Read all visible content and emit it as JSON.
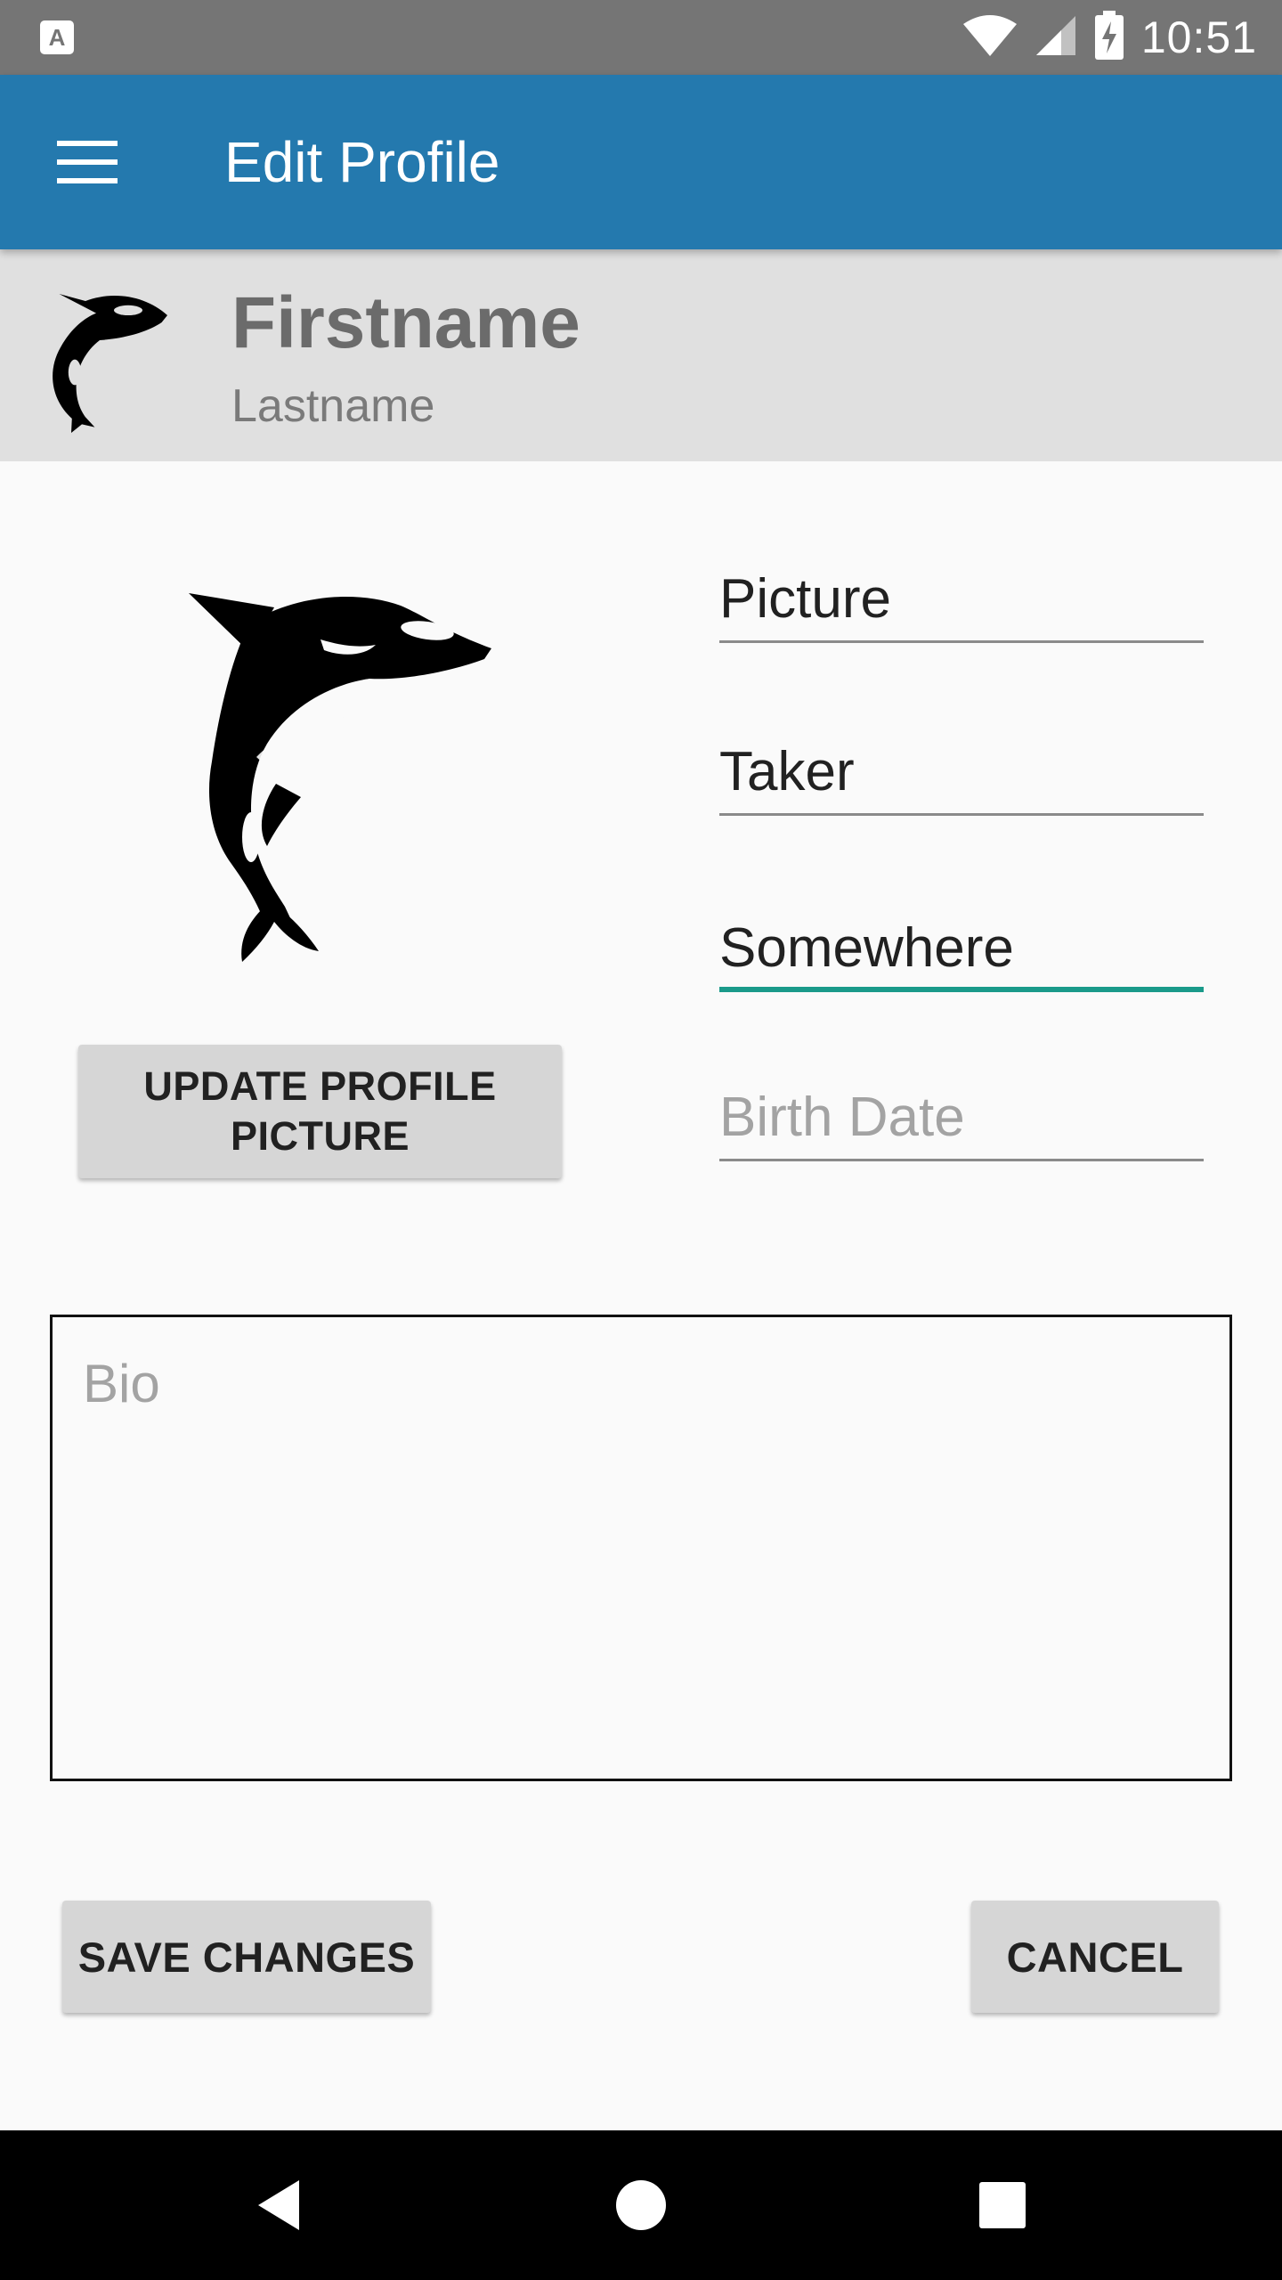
{
  "status_bar": {
    "time": "10:51",
    "icons": [
      "notification-a-icon",
      "wifi-icon",
      "cellular-signal-icon",
      "battery-charging-icon"
    ]
  },
  "app_bar": {
    "title": "Edit Profile",
    "menu_icon": "hamburger-menu-icon",
    "color": "#2479ae"
  },
  "profile_header": {
    "avatar_icon": "orca-icon",
    "firstname": "Firstname",
    "lastname": "Lastname"
  },
  "profile_picture": {
    "icon": "orca-icon",
    "update_button_label": "UPDATE PROFILE PICTURE"
  },
  "form": {
    "fields": [
      {
        "name": "first-name",
        "value": "Picture",
        "placeholder": "",
        "focused": false
      },
      {
        "name": "last-name",
        "value": "Taker",
        "placeholder": "",
        "focused": false
      },
      {
        "name": "location",
        "value": "Somewhere",
        "placeholder": "",
        "focused": true
      },
      {
        "name": "birth-date",
        "value": "",
        "placeholder": "Birth Date",
        "focused": false
      }
    ],
    "bio": {
      "value": "",
      "placeholder": "Bio"
    },
    "focus_color": "#1a9a8a"
  },
  "actions": {
    "save_label": "SAVE CHANGES",
    "cancel_label": "CANCEL"
  },
  "nav_bar": {
    "icons": [
      "back-icon",
      "home-icon",
      "recents-icon"
    ]
  }
}
